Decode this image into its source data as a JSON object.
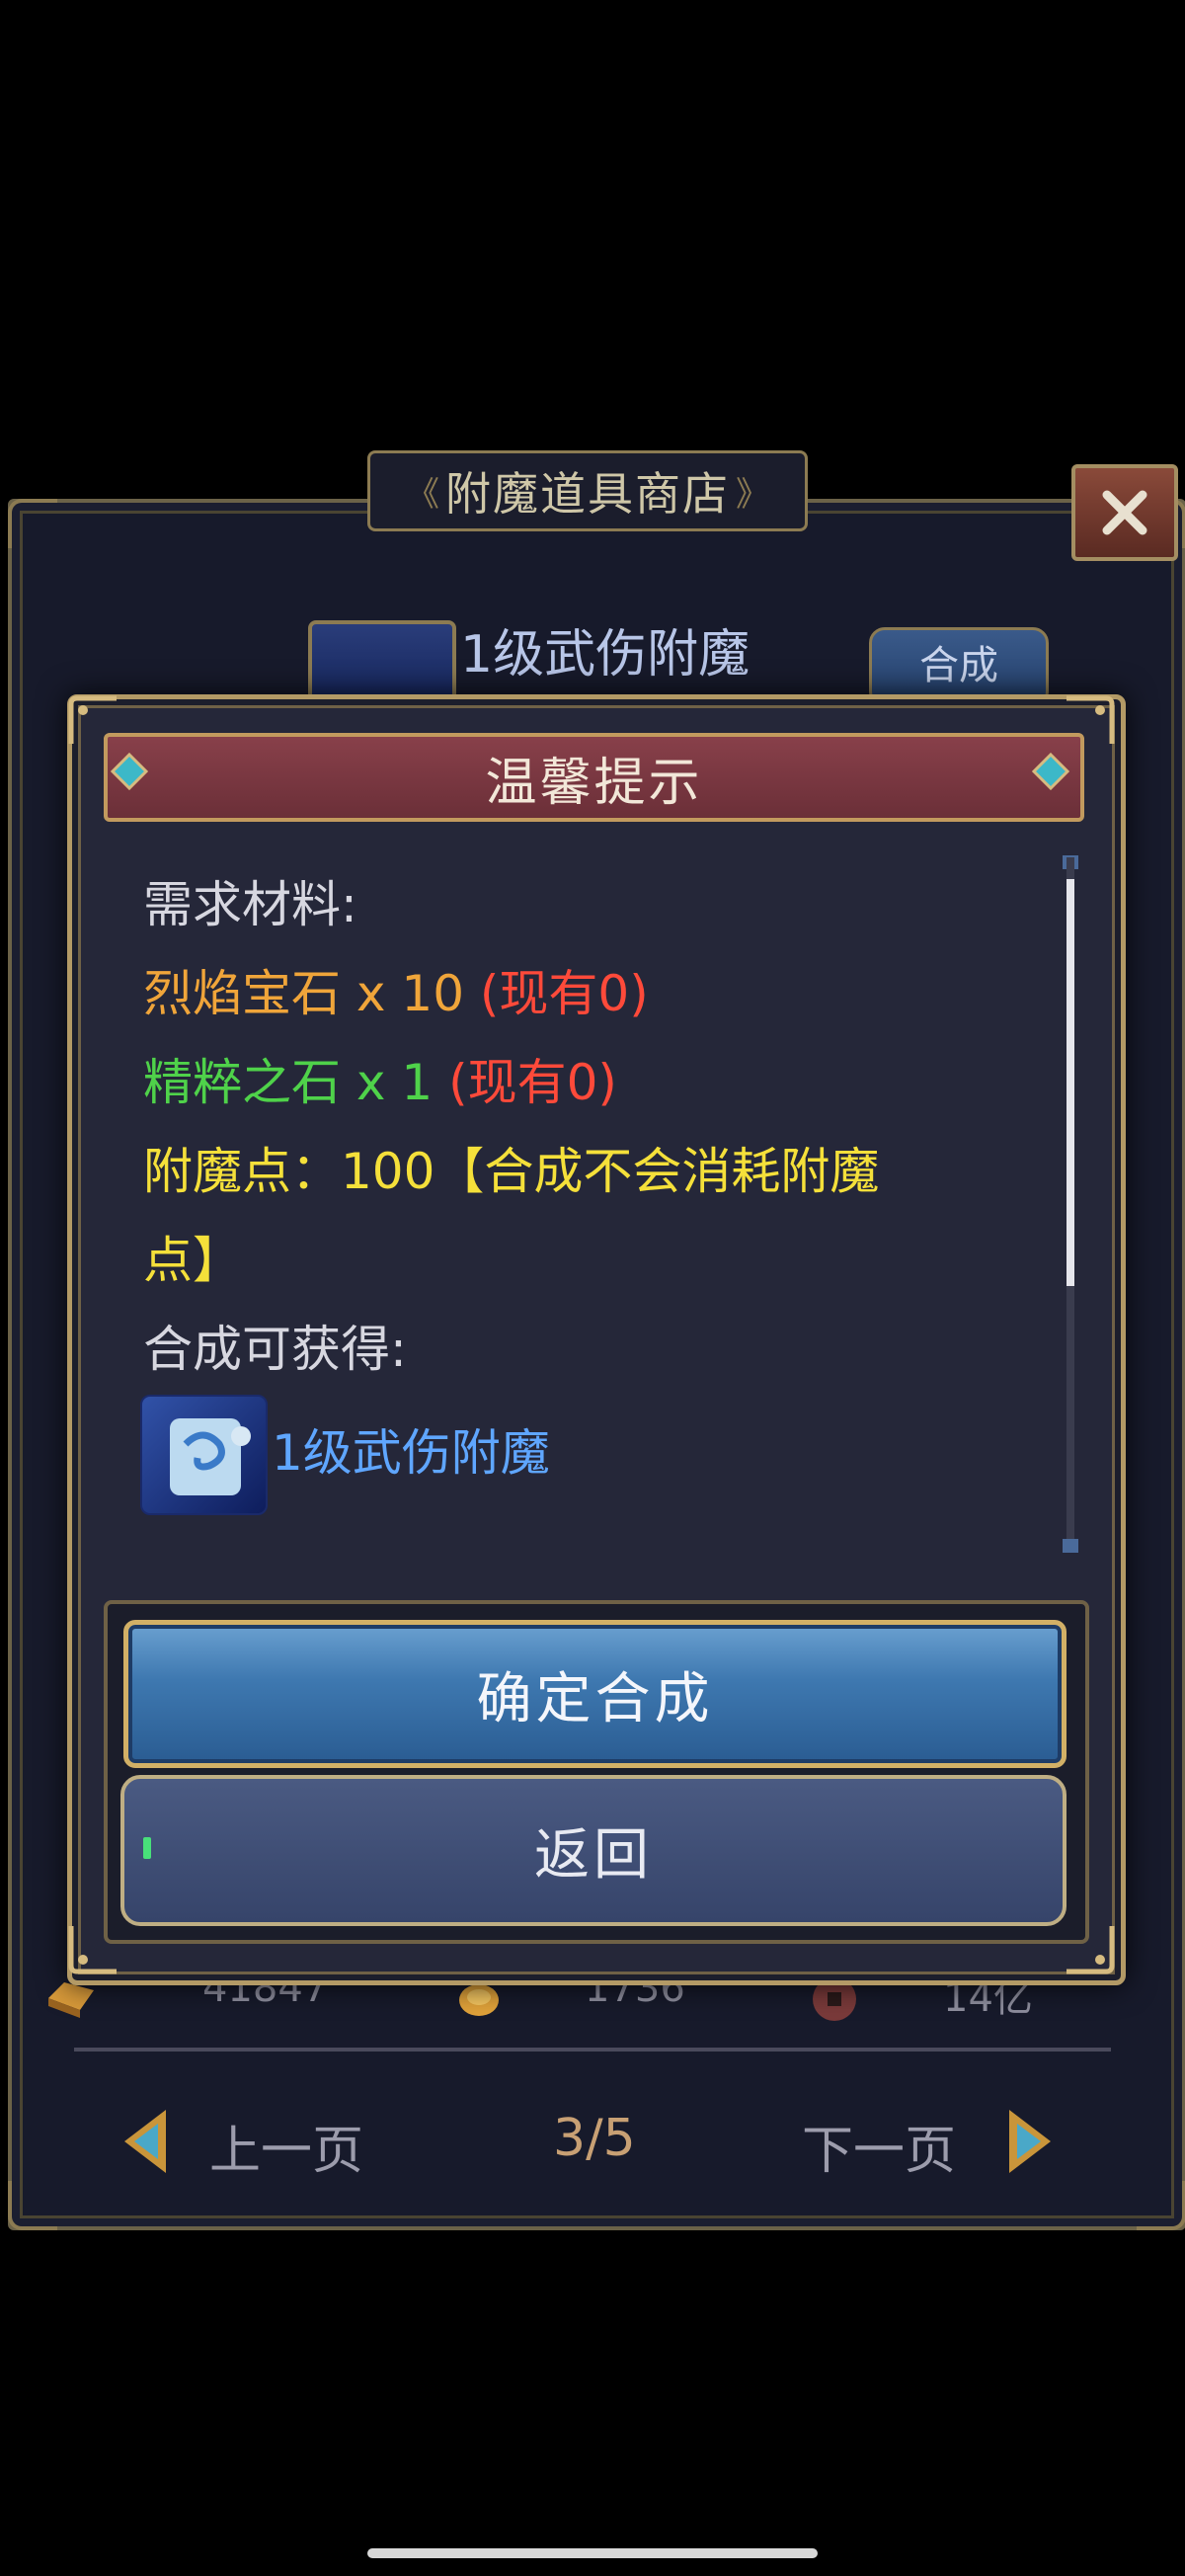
{
  "shop": {
    "title": "附魔道具商店",
    "item_name": "1级武伤附魔",
    "synth_button": "合成",
    "currencies": [
      {
        "icon": "gold-ingot-icon",
        "value": "41847"
      },
      {
        "icon": "gold-leaf-icon",
        "value": "1736"
      },
      {
        "icon": "coin-icon",
        "value": "14亿"
      }
    ],
    "pager": {
      "prev_label": "上一页",
      "next_label": "下一页",
      "page": "3/5"
    }
  },
  "dialog": {
    "title": "温馨提示",
    "materials_label": "需求材料:",
    "materials": [
      {
        "name": "烈焰宝石 x 10",
        "owned": "(现有0)",
        "color": "#f0a53a"
      },
      {
        "name": "精粹之石 x 1",
        "owned": "(现有0)",
        "color": "#4fd24a"
      }
    ],
    "enchant_points_line1": "附魔点：100【合成不会消耗附魔",
    "enchant_points_line2": "点】",
    "gain_label": "合成可获得:",
    "reward_name": "1级武伤附魔",
    "confirm_label": "确定合成",
    "back_label": "返回"
  },
  "colors": {
    "orange": "#f0a53a",
    "green": "#4fd24a",
    "red": "#ff4a3a",
    "yellow": "#f5e03a",
    "blue": "#5fa6ff"
  }
}
